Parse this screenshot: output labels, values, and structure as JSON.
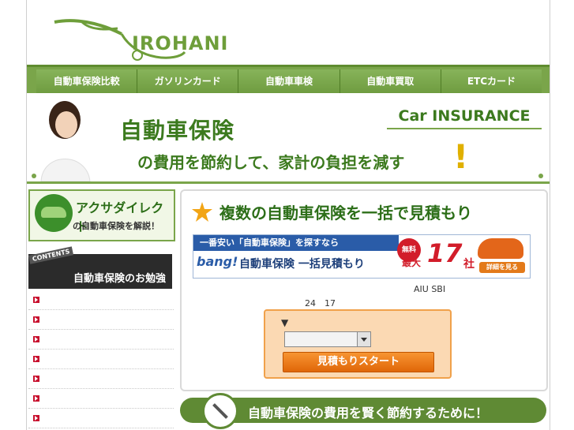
{
  "logo": {
    "text": "IROHANI"
  },
  "nav": {
    "items": [
      {
        "label": "自動車保険比較"
      },
      {
        "label": "ガソリンカード"
      },
      {
        "label": "自動車車検"
      },
      {
        "label": "自動車買取"
      },
      {
        "label": "ETCカード"
      }
    ]
  },
  "hero": {
    "title": "自動車保険",
    "subtitle": "の費用を節約して、家計の負担を減す",
    "exclaim": "!",
    "tag": "Car INSURANCE"
  },
  "sidebar": {
    "banner_title": "アクサダイレクト",
    "banner_sub": "の自動車保険を解説！",
    "contents_tag": "CONTENTS",
    "contents_title": "自動車保険のお勉強",
    "items": [
      "",
      "",
      "",
      "",
      "",
      "",
      ""
    ]
  },
  "main": {
    "title": "複数の自動車保険を一括で見積もり",
    "bang": {
      "top": "一番安い「自動車保険」を探すなら",
      "logo": "bang!",
      "main": "自動車保険 一括見積もり",
      "free": "無料",
      "max": "最大",
      "num": "17",
      "unit": "社",
      "detail": "詳細を見る"
    },
    "aiu": "AIU SBI",
    "numbers": "24　17",
    "form_arrow": "▼",
    "start_label": "見積もりスタート"
  },
  "bottom": {
    "text": "自動車保険の費用を賢く節約するために！"
  },
  "colors": {
    "brand_green": "#7aa54a",
    "dark_green": "#2c6e18",
    "orange": "#f0a14b",
    "red": "#d21d2a"
  }
}
